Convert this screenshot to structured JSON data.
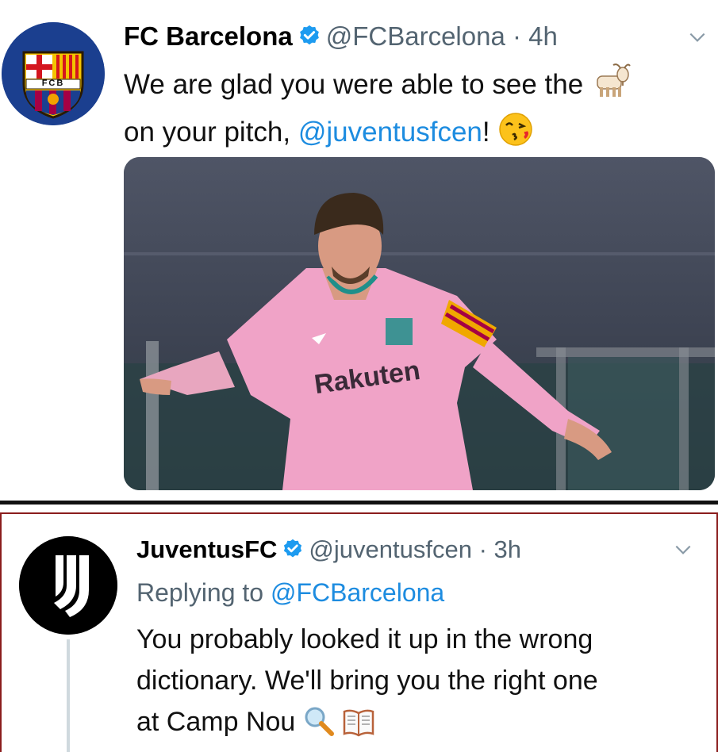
{
  "tweets": [
    {
      "author": "FC Barcelona",
      "handle": "@FCBarcelona",
      "sep": "·",
      "time": "4h",
      "line1": "We are glad you were able to see the",
      "line2_pre": "on your pitch, ",
      "line2_mention": "@juventusfcen",
      "line2_post": "!",
      "emoji": [
        "goat-emoji",
        "kissing-face-emoji"
      ],
      "media_text": "Rakuten"
    },
    {
      "author": "JuventusFC",
      "handle": "@juventusfcen",
      "sep": "·",
      "time": "3h",
      "reply_prefix": "Replying to ",
      "reply_to": "@FCBarcelona",
      "line1": "You probably looked it up in the wrong",
      "line2": "dictionary. We'll bring you the right one",
      "line3": "at Camp Nou",
      "emoji": [
        "magnifying-glass-emoji",
        "book-emoji"
      ]
    }
  ],
  "avatars": {
    "fcb_text": "FCB"
  },
  "colors": {
    "link": "#1d8ce0",
    "verified": "#1d9bf0",
    "muted": "#536471",
    "reply_border": "#8b1d1d"
  }
}
